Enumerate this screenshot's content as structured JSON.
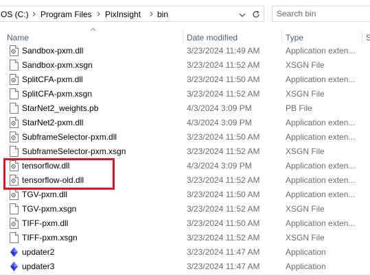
{
  "address_bar": {
    "crumbs": [
      "OS (C:)",
      "Program Files",
      "PixInsight",
      "bin"
    ],
    "search_placeholder": "Search bin"
  },
  "columns": {
    "name": "Name",
    "date": "Date modified",
    "type": "Type",
    "size": "S"
  },
  "sort": {
    "column": "name",
    "direction": "ascending"
  },
  "files": [
    {
      "name": "Sandbox-pxm.dll",
      "date": "3/23/2024 11:49 AM",
      "type": "Application exten...",
      "icon": "dll-file-icon"
    },
    {
      "name": "Sandbox-pxm.xsgn",
      "date": "3/23/2024 11:52 AM",
      "type": "XSGN File",
      "icon": "blank-file-icon"
    },
    {
      "name": "SplitCFA-pxm.dll",
      "date": "3/23/2024 11:50 AM",
      "type": "Application exten...",
      "icon": "dll-file-icon"
    },
    {
      "name": "SplitCFA-pxm.xsgn",
      "date": "3/23/2024 11:52 AM",
      "type": "XSGN File",
      "icon": "blank-file-icon"
    },
    {
      "name": "StarNet2_weights.pb",
      "date": "4/3/2024 3:09 PM",
      "type": "PB File",
      "icon": "blank-file-icon"
    },
    {
      "name": "StarNet2-pxm.dll",
      "date": "4/3/2024 3:09 PM",
      "type": "Application exten...",
      "icon": "dll-file-icon"
    },
    {
      "name": "SubframeSelector-pxm.dll",
      "date": "3/23/2024 11:50 AM",
      "type": "Application exten...",
      "icon": "dll-file-icon"
    },
    {
      "name": "SubframeSelector-pxm.xsgn",
      "date": "3/23/2024 11:52 AM",
      "type": "XSGN File",
      "icon": "blank-file-icon"
    },
    {
      "name": "tensorflow.dll",
      "date": "4/3/2024 3:09 PM",
      "type": "Application exten...",
      "icon": "dll-file-icon"
    },
    {
      "name": "tensorflow-old.dll",
      "date": "3/23/2024 11:52 AM",
      "type": "Application exten...",
      "icon": "dll-file-icon"
    },
    {
      "name": "TGV-pxm.dll",
      "date": "3/23/2024 11:50 AM",
      "type": "Application exten...",
      "icon": "dll-file-icon"
    },
    {
      "name": "TGV-pxm.xsgn",
      "date": "3/23/2024 11:52 AM",
      "type": "XSGN File",
      "icon": "blank-file-icon"
    },
    {
      "name": "TIFF-pxm.dll",
      "date": "3/23/2024 11:50 AM",
      "type": "Application exten...",
      "icon": "dll-file-icon"
    },
    {
      "name": "TIFF-pxm.xsgn",
      "date": "3/23/2024 11:52 AM",
      "type": "XSGN File",
      "icon": "blank-file-icon"
    },
    {
      "name": "updater2",
      "date": "3/23/2024 11:47 AM",
      "type": "Application",
      "icon": "app-gem-icon"
    },
    {
      "name": "updater3",
      "date": "3/23/2024 11:47 AM",
      "type": "Application",
      "icon": "app-gem-icon"
    }
  ],
  "highlight": {
    "color": "#e81123",
    "files": [
      "tensorflow.dll",
      "tensorflow-old.dll"
    ]
  },
  "colors": {
    "header_text": "#4c607a",
    "secondary_text": "#6d6d6d",
    "hover": "#e5f3ff",
    "app_icon": "#3d4ff0"
  }
}
